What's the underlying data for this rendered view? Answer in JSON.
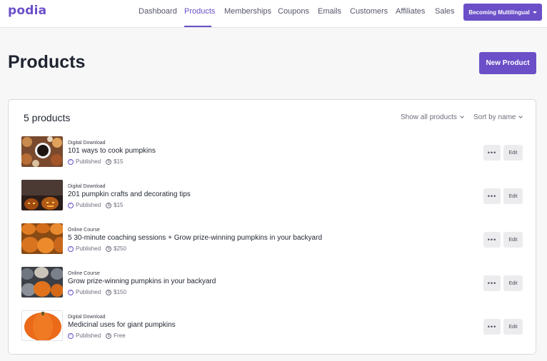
{
  "header": {
    "logo": "podia",
    "nav": [
      "Dashboard",
      "Products",
      "Memberships",
      "Coupons",
      "Emails",
      "Customers",
      "Affiliates",
      "Sales"
    ],
    "active_tab": "Products",
    "site_button": "Becoming Multilingual",
    "accent": "#6b4fc8"
  },
  "page": {
    "title": "Products",
    "new_button": "New Product"
  },
  "card": {
    "count": "5 products",
    "filter": "Show all products",
    "sort": "Sort by name"
  },
  "products": [
    {
      "type": "Digital Download",
      "name": "101 ways to cook pumpkins",
      "status": "Published",
      "price": "$15",
      "image": "coffee-pumpkin-photo"
    },
    {
      "type": "Digital Download",
      "name": "201 pumpkin crafts and decorating tips",
      "status": "Published",
      "price": "$15",
      "image": "jack-o-lantern-photo"
    },
    {
      "type": "Online Course",
      "name": "5 30-minute coaching sessions + Grow prize-winning pumpkins in your backyard",
      "status": "Published",
      "price": "$250",
      "image": "pumpkin-patch-photo"
    },
    {
      "type": "Online Course",
      "name": "Grow prize-winning pumpkins in your backyard",
      "status": "Published",
      "price": "$150",
      "image": "pumpkin-pile-photo"
    },
    {
      "type": "Digital Download",
      "name": "Medicinal uses for giant pumpkins",
      "status": "Published",
      "price": "Free",
      "image": "single-pumpkin-photo"
    }
  ],
  "row_actions": {
    "more": "•••",
    "edit": "Edit"
  }
}
